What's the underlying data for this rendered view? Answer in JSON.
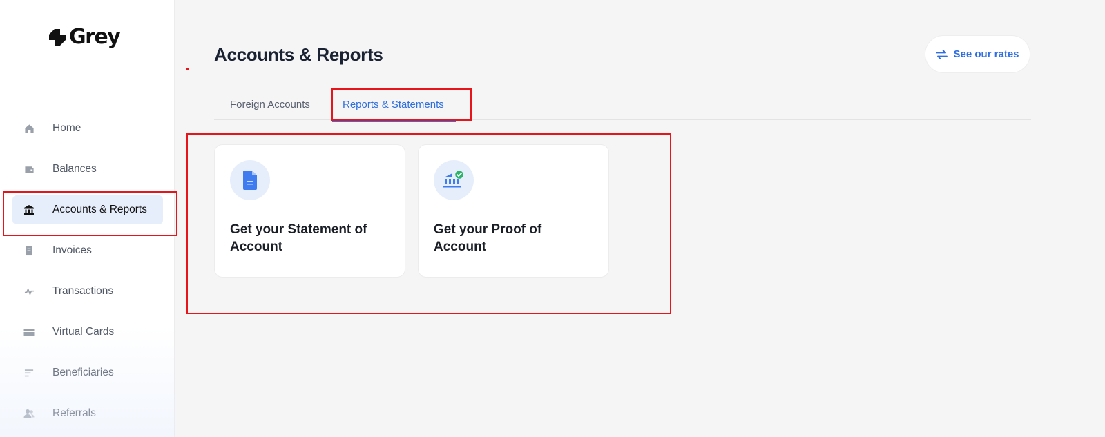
{
  "brand": {
    "name": "Grey"
  },
  "sidebar": {
    "items": [
      {
        "label": "Home",
        "icon": "home-icon"
      },
      {
        "label": "Balances",
        "icon": "wallet-icon"
      },
      {
        "label": "Accounts & Reports",
        "icon": "bank-icon",
        "active": true
      },
      {
        "label": "Invoices",
        "icon": "invoice-icon"
      },
      {
        "label": "Transactions",
        "icon": "activity-icon"
      },
      {
        "label": "Virtual Cards",
        "icon": "card-icon"
      },
      {
        "label": "Beneficiaries",
        "icon": "list-icon"
      },
      {
        "label": "Referrals",
        "icon": "users-icon"
      }
    ]
  },
  "header": {
    "title": "Accounts & Reports",
    "rates_button": "See our rates"
  },
  "tabs": [
    {
      "label": "Foreign Accounts"
    },
    {
      "label": "Reports & Statements",
      "active": true
    }
  ],
  "cards": [
    {
      "title": "Get your Statement of Account",
      "icon": "document-icon"
    },
    {
      "title": "Get your Proof of Account",
      "icon": "bank-verified-icon"
    }
  ],
  "colors": {
    "accent": "#2f6fe0",
    "highlight": "#e8141b",
    "active_bg": "#e7eefb",
    "check": "#2fb36b"
  }
}
